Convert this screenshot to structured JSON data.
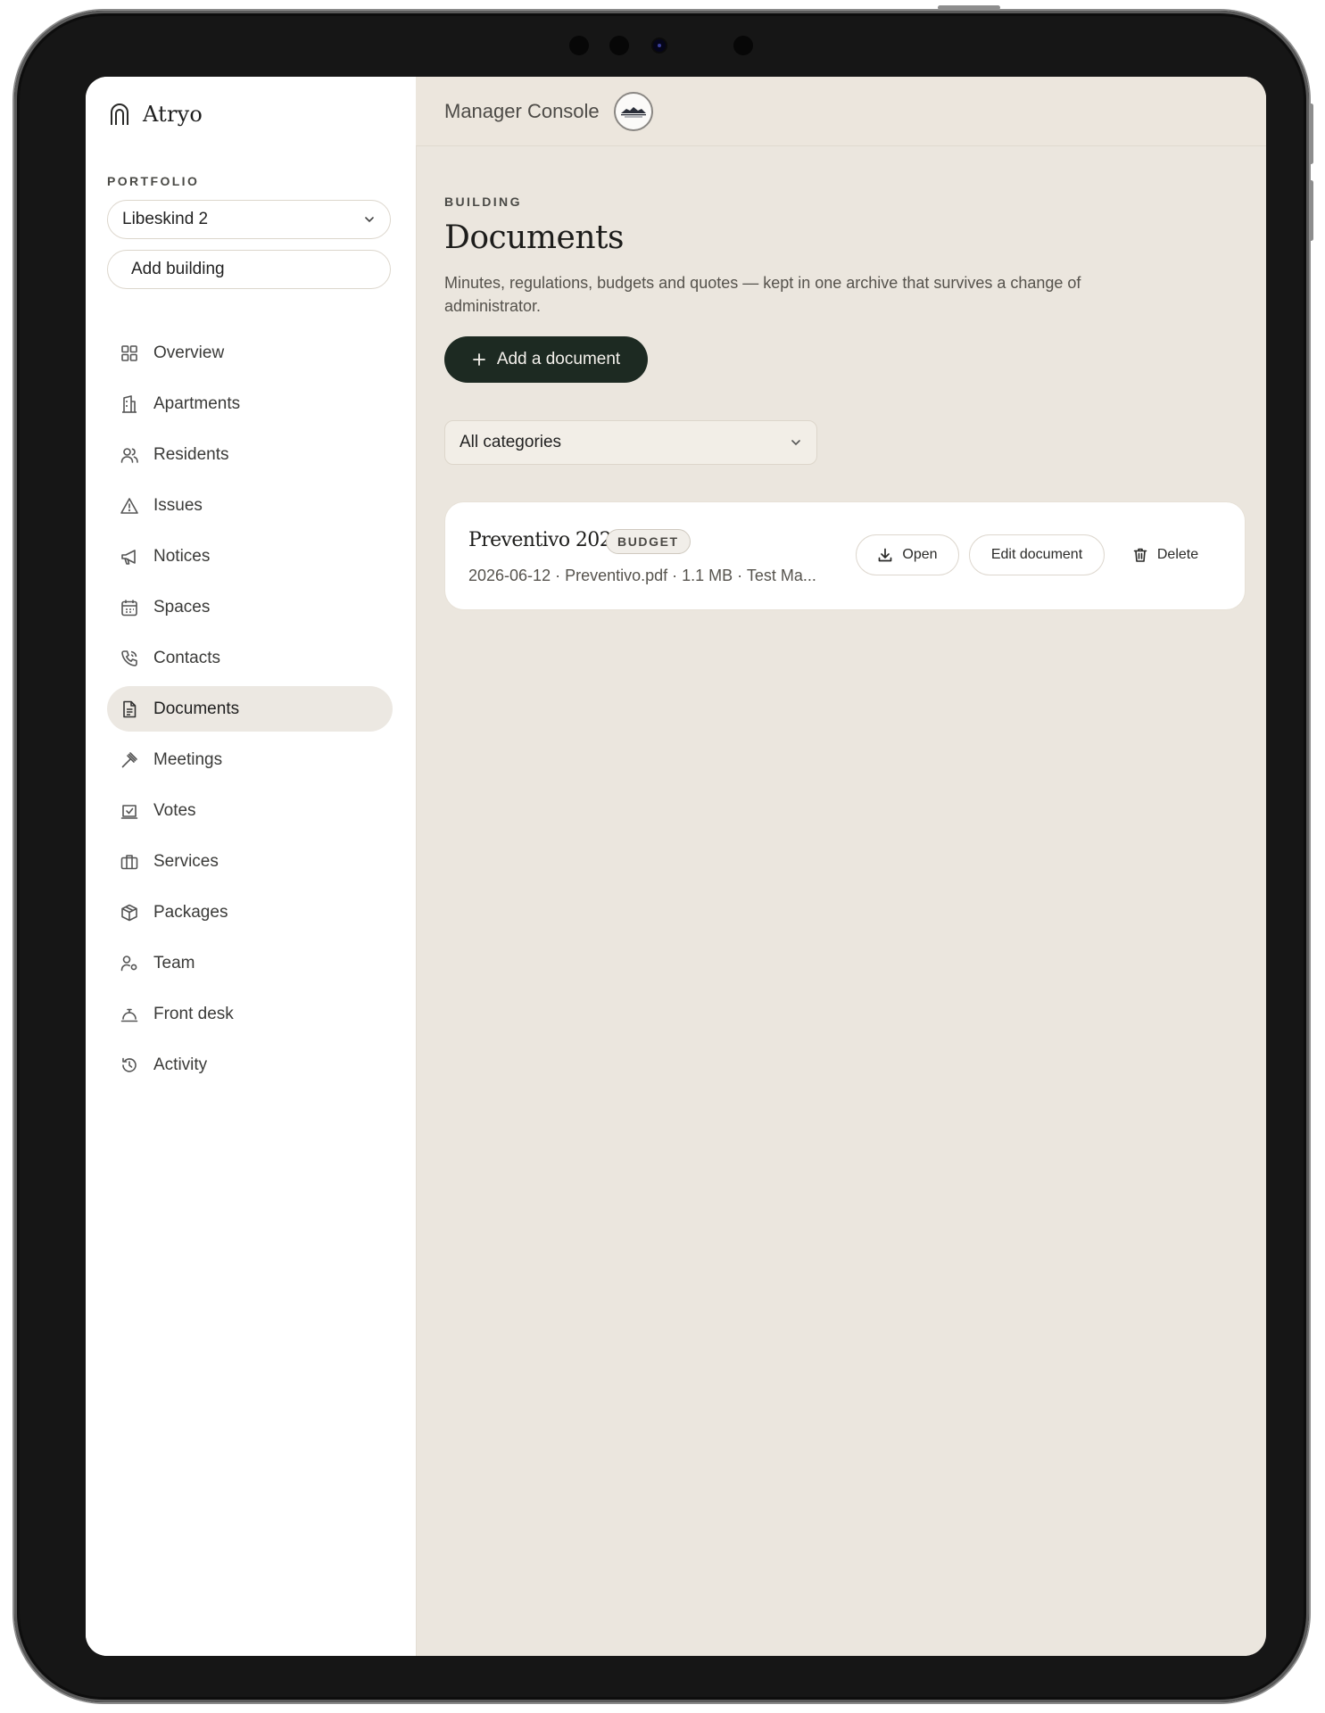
{
  "sidebar": {
    "brand": "Atryo",
    "portfolio_label": "PORTFOLIO",
    "building_select": "Libeskind 2",
    "add_building": "Add building",
    "items": [
      {
        "label": "Overview",
        "icon": "grid-icon"
      },
      {
        "label": "Apartments",
        "icon": "building-icon"
      },
      {
        "label": "Residents",
        "icon": "users-icon"
      },
      {
        "label": "Issues",
        "icon": "warning-icon"
      },
      {
        "label": "Notices",
        "icon": "megaphone-icon"
      },
      {
        "label": "Spaces",
        "icon": "calendar-icon"
      },
      {
        "label": "Contacts",
        "icon": "phone-icon"
      },
      {
        "label": "Documents",
        "icon": "document-icon",
        "active": true
      },
      {
        "label": "Meetings",
        "icon": "gavel-icon"
      },
      {
        "label": "Votes",
        "icon": "ballot-icon"
      },
      {
        "label": "Services",
        "icon": "briefcase-icon"
      },
      {
        "label": "Packages",
        "icon": "package-icon"
      },
      {
        "label": "Team",
        "icon": "user-gear-icon"
      },
      {
        "label": "Front desk",
        "icon": "bell-icon"
      },
      {
        "label": "Activity",
        "icon": "history-icon"
      }
    ]
  },
  "header": {
    "title": "Manager Console"
  },
  "main": {
    "eyebrow": "BUILDING",
    "title": "Documents",
    "description": "Minutes, regulations, budgets and quotes — kept in one archive that survives a change of administrator.",
    "add_button": "Add a document",
    "category_filter": "All categories",
    "documents": [
      {
        "name": "Preventivo 2026",
        "badge": "BUDGET",
        "meta": "2026-06-12 · Preventivo.pdf · 1.1 MB · Test Ma...",
        "open_label": "Open",
        "edit_label": "Edit document",
        "delete_label": "Delete"
      }
    ]
  },
  "colors": {
    "primary_button": "#1d2a22",
    "page_background": "#ebe6de",
    "active_nav": "#ece8e2"
  }
}
